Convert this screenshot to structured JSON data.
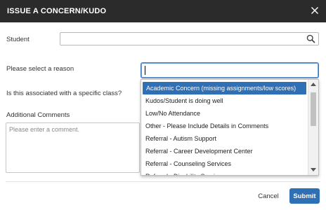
{
  "dialog": {
    "title": "ISSUE A CONCERN/KUDO",
    "close_icon": "close-icon"
  },
  "form": {
    "student_label": "Student",
    "student_value": "",
    "search_icon": "search-icon",
    "reason_label": "Please select a reason",
    "reason_value": "",
    "class_label": "Is this associated with a specific class?",
    "comments_label": "Additional Comments",
    "comments_placeholder": "Please enter a comment."
  },
  "dropdown": {
    "options": [
      "Academic Concern (missing assignments/low scores)",
      "Kudos/Student is doing well",
      "Low/No Attendance",
      "Other - Please Include Details in Comments",
      "Referral - Autism Support",
      "Referral - Career Development Center",
      "Referral - Counseling Services",
      "Referral - Disability Services"
    ],
    "highlighted_index": 0
  },
  "footer": {
    "cancel_label": "Cancel",
    "submit_label": "Submit"
  },
  "colors": {
    "titlebar": "#2b2b2b",
    "accent": "#2f6fb5"
  }
}
